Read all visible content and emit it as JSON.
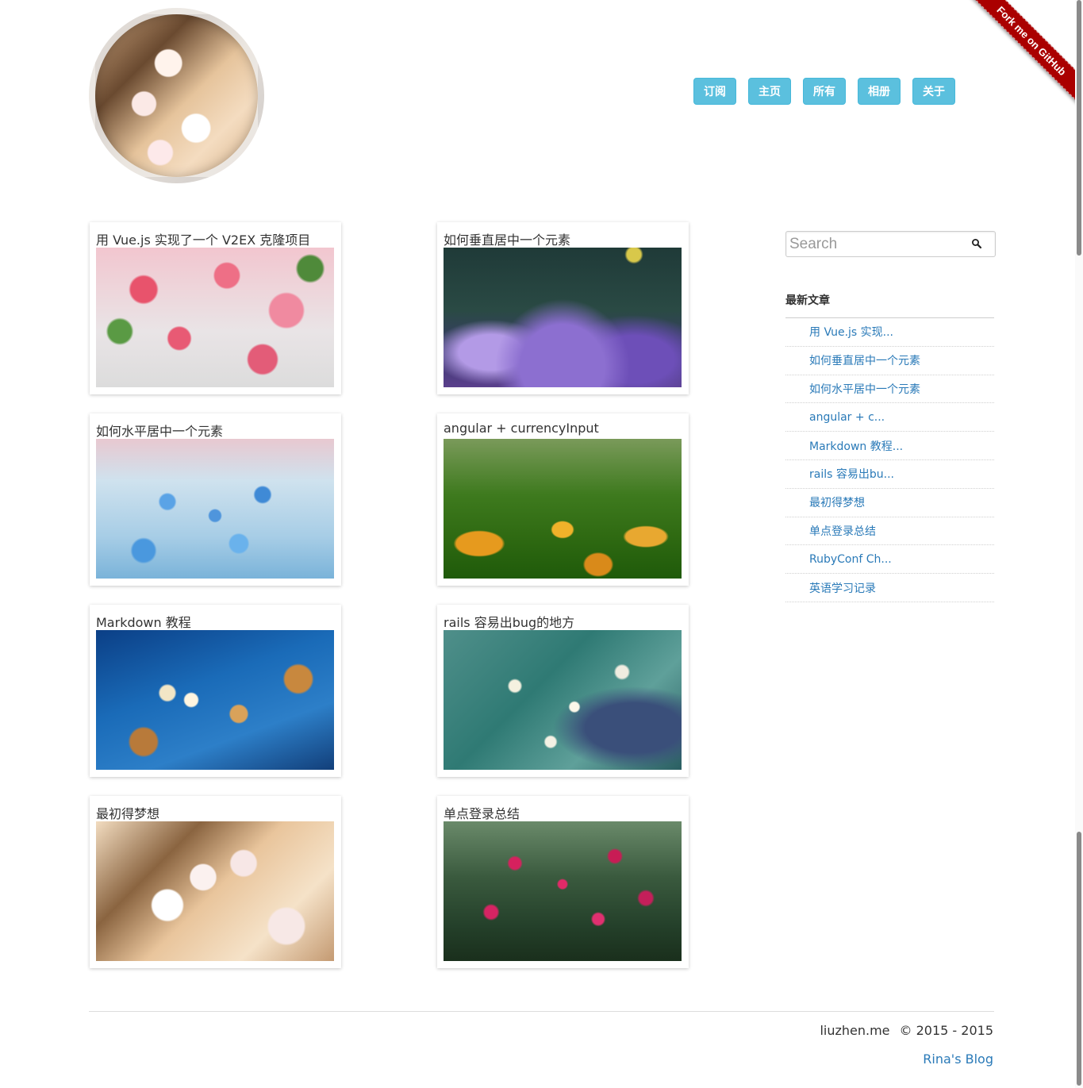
{
  "ribbon": {
    "label": "Fork me on GitHub"
  },
  "nav": {
    "items": [
      {
        "label": "订阅"
      },
      {
        "label": "主页"
      },
      {
        "label": "所有"
      },
      {
        "label": "相册"
      },
      {
        "label": "关于"
      }
    ]
  },
  "posts": [
    {
      "title": "用 Vue.js 实现了一个 V2EX 克隆项目"
    },
    {
      "title": "如何垂直居中一个元素"
    },
    {
      "title": "如何水平居中一个元素"
    },
    {
      "title": "angular + currencyInput"
    },
    {
      "title": "Markdown 教程"
    },
    {
      "title": "rails 容易出bug的地方"
    },
    {
      "title": "最初得梦想"
    },
    {
      "title": "单点登录总结"
    }
  ],
  "search": {
    "placeholder": "Search"
  },
  "sidebar": {
    "recent_title": "最新文章",
    "recent": [
      "用 Vue.js 实现...",
      "如何垂直居中一个元素",
      "如何水平居中一个元素",
      "angular + c...",
      "Markdown 教程...",
      "rails 容易出bu...",
      "最初得梦想",
      "单点登录总结",
      "RubyConf Ch...",
      "英语学习记录"
    ]
  },
  "footer": {
    "site": "liuzhen.me",
    "copyright": "© 2015 - 2015",
    "link": "Rina's Blog"
  },
  "colors": {
    "nav_button": "#5bc0de",
    "link": "#2a7ab8",
    "ribbon": "#aa0000"
  }
}
